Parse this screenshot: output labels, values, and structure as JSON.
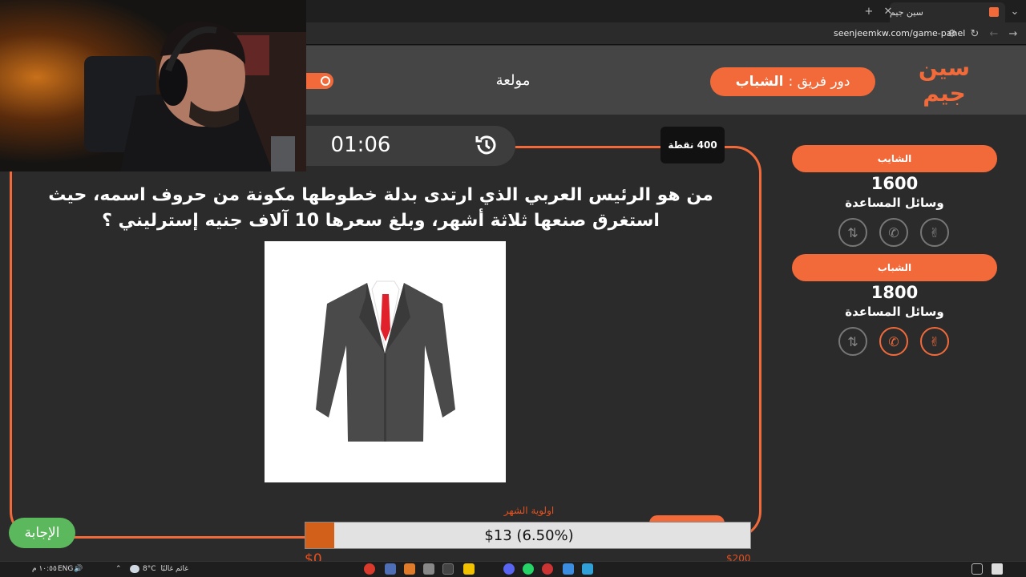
{
  "browser": {
    "tab_title": "سين جيم",
    "url": "seenjeemkw.com/game-panel"
  },
  "app": {
    "logo_text": "سين جيم",
    "turn_label": "دور فريق :",
    "turn_team": "الشباب",
    "category": "مولعة",
    "accent_color": "#f26a3a"
  },
  "question": {
    "timer": "01:06",
    "points": "400 نقطة",
    "text": "من هو الرئيس العربي الذي ارتدى بدلة خطوطها مكونة من حروف اسمه، حيث استغرق صنعها ثلاثة أشهر، وبلغ سعرها 10 آلاف جنيه إسترليني ؟",
    "image_icon": "suit-jacket-icon",
    "answer_button": "الإجابة"
  },
  "teams": [
    {
      "name": "الشايب",
      "score": "1600",
      "help_label": "وسائل المساعدة",
      "help_active": [
        false,
        false,
        false
      ]
    },
    {
      "name": "الشباب",
      "score": "1800",
      "help_label": "وسائل المساعدة",
      "help_active": [
        false,
        true,
        true
      ]
    }
  ],
  "donation": {
    "title": "اولوية الشهر",
    "current": "$13 (6.50%)",
    "progress_fraction": 0.065,
    "min": "$0",
    "max": "$200"
  },
  "taskbar": {
    "weather": "غائم غالبًا",
    "temperature": "8°C",
    "language": "ENG",
    "time": "١٠:٥٥ م"
  }
}
